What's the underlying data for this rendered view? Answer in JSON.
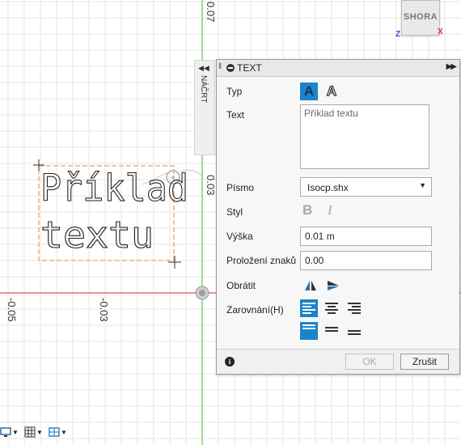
{
  "canvas": {
    "ruler_top": "0.07",
    "ruler_mid": "0.03",
    "ruler_left_1": "-0.05",
    "ruler_left_2": "-0.03",
    "sketch_line1": "Příklad",
    "sketch_line2": "textu"
  },
  "viewcube": {
    "face": "SHORA",
    "axis_x": "X",
    "axis_z": "Z"
  },
  "browser_tab": {
    "arrows": "◀◀",
    "label": "NÁČRT"
  },
  "dialog": {
    "title": "TEXT",
    "expand_icon": "▶▶",
    "labels": {
      "type": "Typ",
      "text": "Text",
      "font": "Písmo",
      "style": "Styl",
      "height": "Výška",
      "spacing": "Proložení znaků",
      "flip": "Obrátit",
      "align": "Zarovnání(H)"
    },
    "type_glyph": "A",
    "text_value": "Příklad textu",
    "font_value": "Isocp.shx",
    "style_bold": "B",
    "style_italic": "I",
    "height_value": "0.01 m",
    "spacing_value": "0.00",
    "ok_label": "OK",
    "cancel_label": "Zrušit",
    "info_glyph": "i",
    "accent_color": "#1b84c8"
  },
  "bottom_toolbar": {
    "icons": [
      "display-settings-icon",
      "grid-settings-icon",
      "viewports-icon"
    ]
  }
}
